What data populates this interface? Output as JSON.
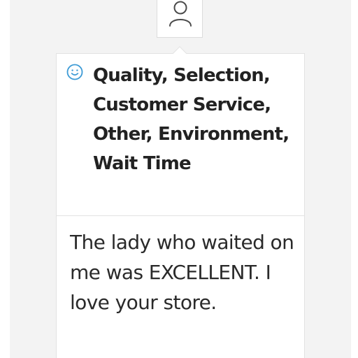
{
  "profile": {
    "avatar_icon": "user-avatar-icon"
  },
  "feedback": {
    "sentiment_icon": "smiley-face-icon",
    "sentiment_color": "#3d9bd6",
    "tags": "Quality, Selection, Customer Service, Other, Environment, Wait Time",
    "comment": "The lady who waited on me was EXCELLENT. I love your store."
  }
}
